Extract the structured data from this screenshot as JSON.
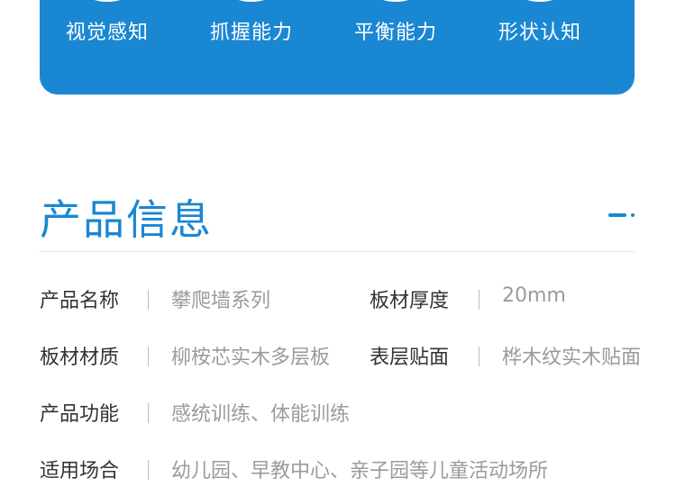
{
  "banner": {
    "skills": [
      "视觉感知",
      "抓握能力",
      "平衡能力",
      "形状认知"
    ]
  },
  "section": {
    "title": "产品信息"
  },
  "info": [
    {
      "label": "产品名称",
      "value": "攀爬墙系列",
      "label2": "板材厚度",
      "value2": "20mm"
    },
    {
      "label": "板材材质",
      "value": "柳桉芯实木多层板",
      "label2": "表层贴面",
      "value2": "桦木纹实木贴面"
    },
    {
      "label": "产品功能",
      "value": "感统训练、体能训练"
    },
    {
      "label": "适用场合",
      "value": "幼儿园、早教中心、亲子园等儿童活动场所"
    }
  ],
  "colors": {
    "accent": "#1a87d3"
  }
}
